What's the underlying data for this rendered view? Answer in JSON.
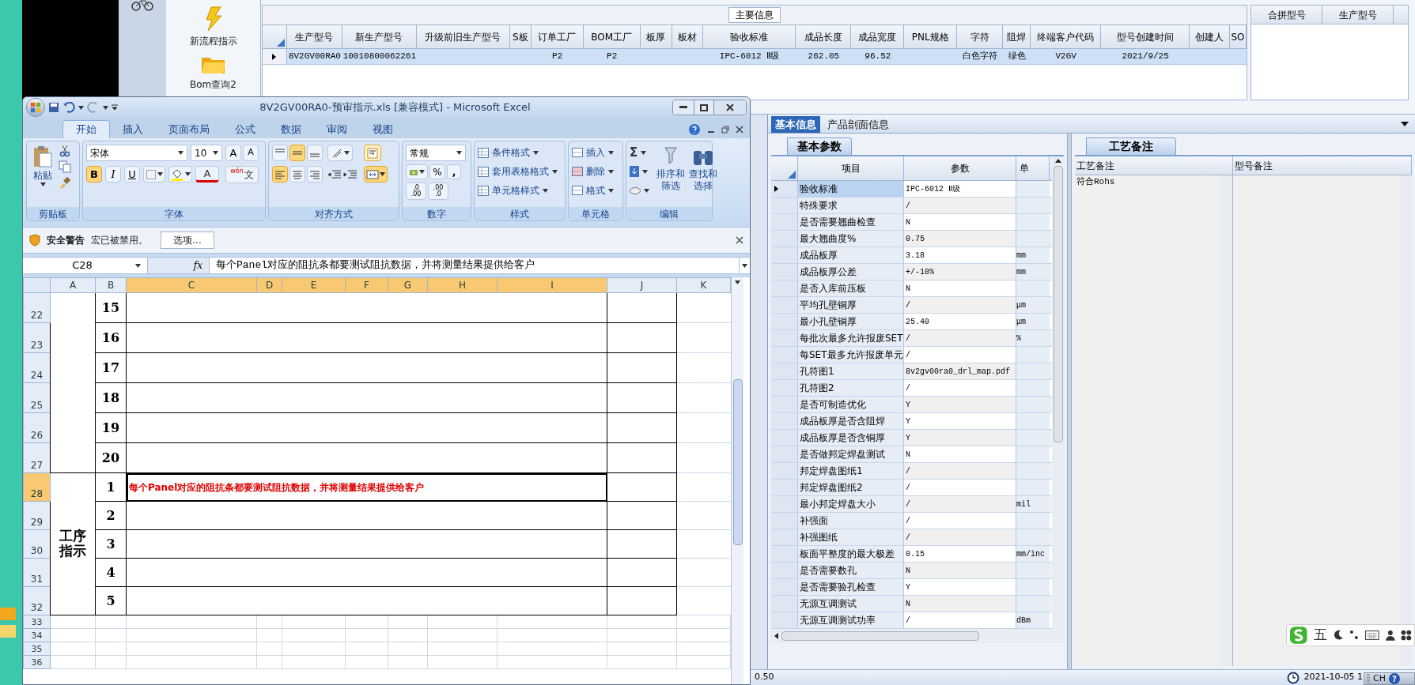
{
  "sidebar": {
    "items": [
      {
        "kind": "flow",
        "label": "新流程指示"
      },
      {
        "kind": "query",
        "label": "Bom查询2"
      }
    ]
  },
  "main_info": {
    "title": "主要信息",
    "columns": [
      "生产型号",
      "新生产型号",
      "升级前旧生产型号",
      "S板",
      "订单工厂",
      "BOM工厂",
      "板厚",
      "板材",
      "验收标准",
      "成品长度",
      "成品宽度",
      "PNL规格",
      "字符",
      "阻焊",
      "终端客户代码",
      "型号创建时间",
      "创建人",
      "SO"
    ],
    "rows": [
      {
        "selected": true,
        "cells": [
          "8V2GV00RA0",
          "10010800062261",
          "",
          "",
          "P2",
          "P2",
          "",
          "",
          "IPC-6012 Ⅱ级",
          "262.05",
          "96.52",
          "",
          "白色字符",
          "绿色",
          "V2GV",
          "2021/9/25",
          "",
          ""
        ]
      }
    ]
  },
  "merge_grid": {
    "columns": [
      "合拼型号",
      "生产型号"
    ]
  },
  "detail": {
    "tabs": [
      {
        "label": "基本信息",
        "selected": true
      },
      {
        "label": "产品剖面信息",
        "selected": false
      }
    ],
    "params": {
      "tab": "基本参数",
      "columns": [
        "项目",
        "参数",
        "单"
      ],
      "rows": [
        {
          "item": "验收标准",
          "value": "IPC-6012 Ⅱ级",
          "unit": "",
          "selected": true
        },
        {
          "item": "特殊要求",
          "value": "/",
          "unit": "",
          "selected": false
        },
        {
          "item": "是否需要翘曲检查",
          "value": "N",
          "unit": "",
          "selected": false
        },
        {
          "item": "最大翘曲度%",
          "value": "0.75",
          "unit": "",
          "selected": false
        },
        {
          "item": "成品板厚",
          "value": "3.18",
          "unit": "mm",
          "selected": false
        },
        {
          "item": "成品板厚公差",
          "value": "+/-10%",
          "unit": "mm",
          "selected": false
        },
        {
          "item": "是否入库前压板",
          "value": "N",
          "unit": "",
          "selected": false
        },
        {
          "item": "平均孔壁铜厚",
          "value": "/",
          "unit": "μm",
          "selected": false
        },
        {
          "item": "最小孔壁铜厚",
          "value": "25.40",
          "unit": "μm",
          "selected": false
        },
        {
          "item": "每批次最多允许报废SET",
          "value": "/",
          "unit": "%",
          "selected": false
        },
        {
          "item": "每SET最多允许报废单元",
          "value": "/",
          "unit": "",
          "selected": false
        },
        {
          "item": "孔符图1",
          "value": "8v2gv00ra0_drl_map.pdf",
          "unit": "",
          "selected": false
        },
        {
          "item": "孔符图2",
          "value": "/",
          "unit": "",
          "selected": false
        },
        {
          "item": "是否可制造优化",
          "value": "Y",
          "unit": "",
          "selected": false
        },
        {
          "item": "成品板厚是否含阻焊",
          "value": "Y",
          "unit": "",
          "selected": false
        },
        {
          "item": "成品板厚是否含铜厚",
          "value": "Y",
          "unit": "",
          "selected": false
        },
        {
          "item": "是否做邦定焊盘测试",
          "value": "N",
          "unit": "",
          "selected": false
        },
        {
          "item": "邦定焊盘图纸1",
          "value": "/",
          "unit": "",
          "selected": false
        },
        {
          "item": "邦定焊盘图纸2",
          "value": "/",
          "unit": "",
          "selected": false
        },
        {
          "item": "最小邦定焊盘大小",
          "value": "/",
          "unit": "mil",
          "selected": false
        },
        {
          "item": "补强面",
          "value": "/",
          "unit": "",
          "selected": false
        },
        {
          "item": "补强图纸",
          "value": "/",
          "unit": "",
          "selected": false
        },
        {
          "item": "板面平整度的最大极差",
          "value": "0.15",
          "unit": "mm/inc",
          "selected": false
        },
        {
          "item": "是否需要数孔",
          "value": "N",
          "unit": "",
          "selected": false
        },
        {
          "item": "是否需要验孔检查",
          "value": "Y",
          "unit": "",
          "selected": false
        },
        {
          "item": "无源互调测试",
          "value": "N",
          "unit": "",
          "selected": false
        },
        {
          "item": "无源互调测试功率",
          "value": "/",
          "unit": "dBm",
          "selected": false
        }
      ]
    },
    "notes": {
      "tab": "工艺备注",
      "columns": [
        "工艺备注",
        "型号备注"
      ],
      "process_note": "符合Rohs"
    }
  },
  "status_bar": {
    "value": "0.50",
    "datetime": "2021-10-05 1"
  },
  "ime": {
    "mode": "五",
    "language": "CH",
    "help": "?"
  },
  "excel": {
    "title": "8V2GV00RA0-预审指示.xls  [兼容模式] - Microsoft Excel",
    "tabs": [
      {
        "label": "开始",
        "selected": true
      },
      {
        "label": "插入",
        "selected": false
      },
      {
        "label": "页面布局",
        "selected": false
      },
      {
        "label": "公式",
        "selected": false
      },
      {
        "label": "数据",
        "selected": false
      },
      {
        "label": "审阅",
        "selected": false
      },
      {
        "label": "视图",
        "selected": false
      }
    ],
    "clipboard": {
      "label": "剪贴板",
      "paste": "粘贴"
    },
    "font": {
      "label": "字体",
      "name": "宋体",
      "size": "10",
      "grow": "A",
      "shrink": "A",
      "color_letter": "A",
      "phonetic_top": "wén",
      "phonetic": "文",
      "styles": [
        {
          "label": "B",
          "on": true
        },
        {
          "label": "I",
          "on": false
        },
        {
          "label": "U",
          "on": false
        }
      ]
    },
    "alignment": {
      "label": "对齐方式",
      "vertical": [
        {
          "on": false
        },
        {
          "on": true
        },
        {
          "on": false
        }
      ],
      "horizontal": [
        {
          "on": true
        },
        {
          "on": false
        },
        {
          "on": false
        }
      ],
      "merge_on": true
    },
    "number": {
      "label": "数字",
      "format": "常规",
      "percent": "%",
      "comma": ",",
      "decimals": [
        {
          "top": ".0",
          "bottom": ".00"
        },
        {
          "top": ".00",
          "bottom": ".0"
        }
      ]
    },
    "styles": {
      "label": "样式",
      "items": [
        "条件格式",
        "套用表格格式",
        "单元格样式"
      ]
    },
    "cells": {
      "label": "单元格",
      "items": [
        "插入",
        "删除",
        "格式"
      ]
    },
    "editing": {
      "label": "编辑",
      "sum": "Σ",
      "sort": "排序和筛选",
      "find": "查找和选择"
    },
    "security": {
      "title": "安全警告",
      "message": "宏已被禁用。",
      "button": "选项..."
    },
    "formula_bar": {
      "name": "C28",
      "fx": "fx",
      "formula": "每个Panel对应的阻抗条都要测试阻抗数据，并将测量结果提供给客户"
    },
    "columns": [
      {
        "label": "A",
        "selected": false
      },
      {
        "label": "B",
        "selected": false
      },
      {
        "label": "C",
        "selected": true
      },
      {
        "label": "D",
        "selected": true
      },
      {
        "label": "E",
        "selected": true
      },
      {
        "label": "F",
        "selected": true
      },
      {
        "label": "G",
        "selected": true
      },
      {
        "label": "H",
        "selected": true
      },
      {
        "label": "I",
        "selected": true
      },
      {
        "label": "J",
        "selected": false
      },
      {
        "label": "K",
        "selected": false
      }
    ],
    "sections": [
      {
        "rows": [
          {
            "header": "22",
            "selected": false,
            "seq": "15"
          },
          {
            "header": "23",
            "selected": false,
            "seq": "16"
          },
          {
            "header": "24",
            "selected": false,
            "seq": "17"
          },
          {
            "header": "25",
            "selected": false,
            "seq": "18"
          },
          {
            "header": "26",
            "selected": false,
            "seq": "19"
          },
          {
            "header": "27",
            "selected": false,
            "seq": "20"
          }
        ]
      },
      {
        "label": "工序指示",
        "rows": [
          {
            "header": "28",
            "selected": true,
            "seq": "1",
            "note": "每个Panel对应的阻抗条都要测试阻抗数据，并将测量结果提供给客户"
          },
          {
            "header": "29",
            "selected": false,
            "seq": "2"
          },
          {
            "header": "30",
            "selected": false,
            "seq": "3"
          },
          {
            "header": "31",
            "selected": false,
            "seq": "4"
          },
          {
            "header": "32",
            "selected": false,
            "seq": "5"
          }
        ]
      }
    ],
    "blank_rows": [
      {
        "header": "33"
      },
      {
        "header": "34"
      },
      {
        "header": "35"
      },
      {
        "header": "36"
      }
    ]
  }
}
